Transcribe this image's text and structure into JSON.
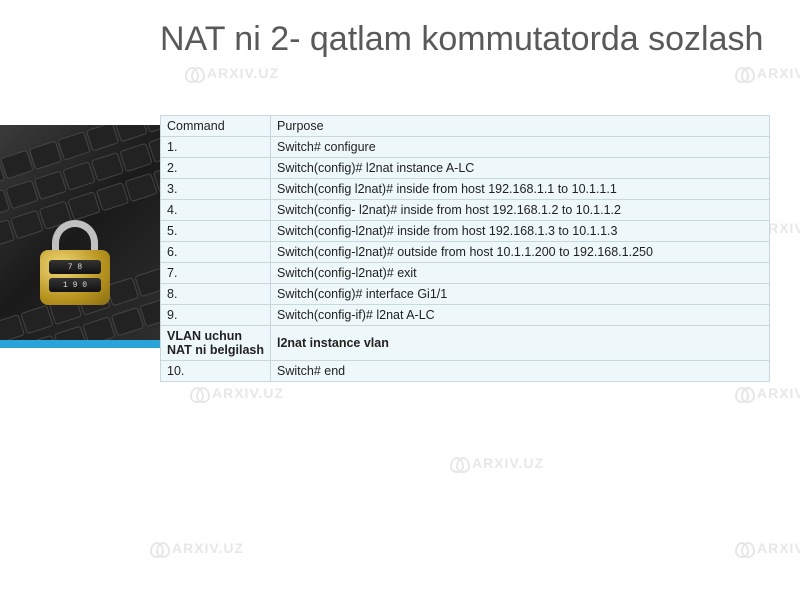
{
  "title": "NAT ni 2- qatlam kommutatorda sozlash",
  "watermark_text": "ARXIV.UZ",
  "table": {
    "header": {
      "left": "Command",
      "right": "Purpose"
    },
    "rows": [
      {
        "left": "1.",
        "right": "Switch# configure"
      },
      {
        "left": "2.",
        "right": "Switch(config)# l2nat instance A-LC"
      },
      {
        "left": "3.",
        "right": "Switch(config l2nat)# inside from host 192.168.1.1 to 10.1.1.1"
      },
      {
        "left": "4.",
        "right": "Switch(config- l2nat)# inside from host 192.168.1.2 to 10.1.1.2"
      },
      {
        "left": "5.",
        "right": "Switch(config-l2nat)# inside from host 192.168.1.3 to 10.1.1.3"
      },
      {
        "left": "6.",
        "right": "Switch(config-l2nat)# outside from host 10.1.1.200 to 192.168.1.250"
      },
      {
        "left": "7.",
        "right": "Switch(config-l2nat)# exit"
      },
      {
        "left": "8.",
        "right": "Switch(config)# interface Gi1/1"
      },
      {
        "left": "9.",
        "right": "Switch(config-if)# l2nat A-LC"
      },
      {
        "left": "VLAN uchun NAT ni belgilash",
        "right": "l2nat instance vlan",
        "bold": true
      },
      {
        "left": "10.",
        "right": "Switch# end"
      }
    ]
  },
  "padlock": {
    "row1": "7 8",
    "row2": "1 9 0"
  }
}
